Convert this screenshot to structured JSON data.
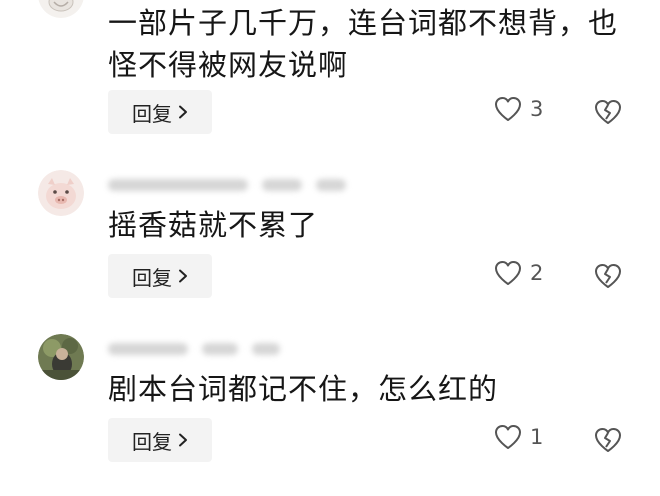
{
  "comments": [
    {
      "text_lines": [
        "一部片子几千万，连台词都不想背，也",
        "怪不得被网友说啊"
      ],
      "reply_label": "回复",
      "like_count": "3",
      "avatar_icon": "avatar-partial"
    },
    {
      "text_lines": [
        "摇香菇就不累了"
      ],
      "reply_label": "回复",
      "like_count": "2",
      "avatar_icon": "avatar-pig"
    },
    {
      "text_lines": [
        "剧本台词都记不住，怎么红的"
      ],
      "reply_label": "回复",
      "like_count": "1",
      "avatar_icon": "avatar-photo"
    }
  ],
  "icons": {
    "like": "heart-outline-icon",
    "dislike": "broken-heart-icon",
    "chevron": "chevron-right-icon"
  }
}
